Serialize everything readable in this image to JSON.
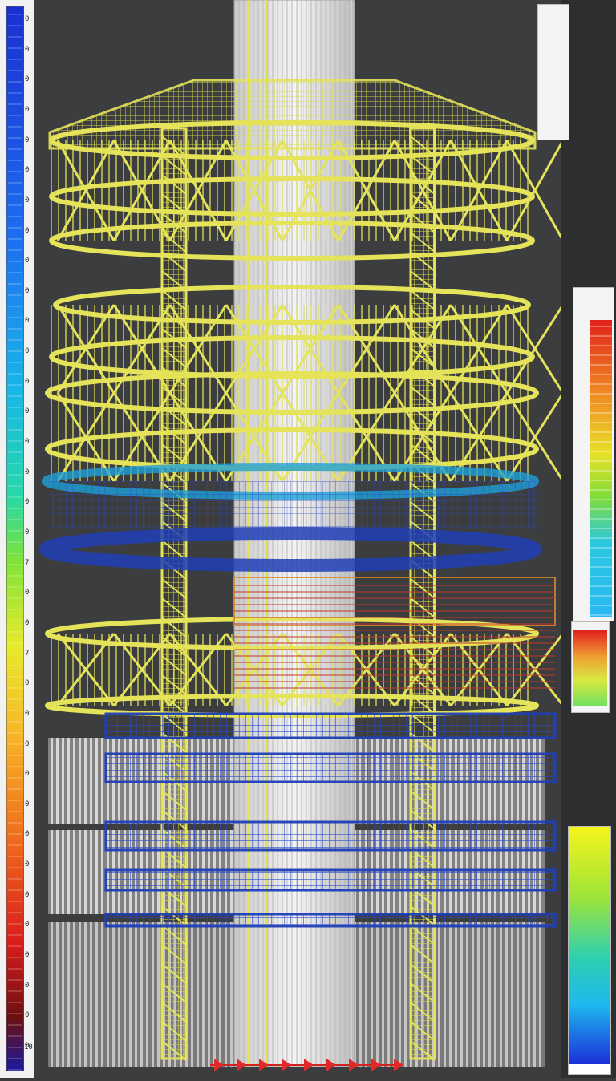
{
  "left_legend": {
    "ticks": [
      "0",
      "0",
      "0",
      "0",
      "0",
      "0",
      "0",
      "0",
      "0",
      "0",
      "0",
      "0",
      "0",
      "0",
      "0",
      "0",
      "0",
      "0",
      "7",
      "0",
      "0",
      "7",
      "0",
      "0",
      "0",
      "0",
      "0",
      "0",
      "0",
      "0",
      "0",
      "0",
      "0",
      "0",
      "0"
    ],
    "bottom_label": "10"
  },
  "right_legends": [
    {
      "caption": "",
      "labels": [
        "",
        "",
        "",
        ""
      ]
    },
    {
      "caption": "",
      "labels": [
        "",
        "",
        "",
        ""
      ]
    },
    {
      "caption": "",
      "labels": [
        "",
        ""
      ]
    },
    {
      "caption": "",
      "labels": [
        "",
        "",
        ""
      ]
    }
  ],
  "colors": {
    "structure": "#e4e35a",
    "core": "#e6e6e6",
    "band_blue": "#1f3fb8",
    "band_cyan": "#1ea0d8",
    "band_red": "#c0392b",
    "band_orange": "#d98a2b",
    "background": "#3c3d3f"
  },
  "icons": [
    "arrow-marker-icon"
  ]
}
